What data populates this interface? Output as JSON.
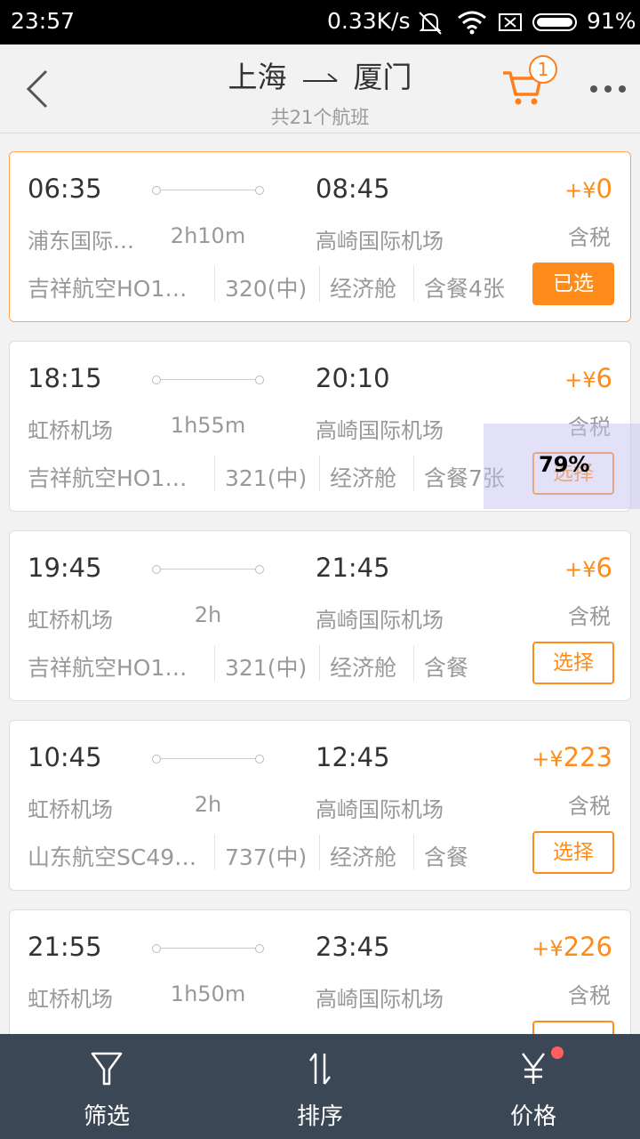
{
  "status_bar": {
    "time": "23:57",
    "network_speed": "0.33K/s",
    "battery": "91%"
  },
  "header": {
    "from": "上海",
    "to": "厦门",
    "subtitle": "共21个航班",
    "cart_count": "1"
  },
  "flights": [
    {
      "dep_time": "06:35",
      "arr_time": "08:45",
      "dep_airport": "浦东国际…",
      "arr_airport": "高崎国际机场",
      "duration": "2h10m",
      "price_prefix": "+¥",
      "price": "0",
      "tax": "含税",
      "airline": "吉祥航空HO1…",
      "plane": "320(中)",
      "cabin": "经济舱",
      "meal": "含餐4张",
      "button": "已选",
      "selected": true
    },
    {
      "dep_time": "18:15",
      "arr_time": "20:10",
      "dep_airport": "虹桥机场",
      "arr_airport": "高崎国际机场",
      "duration": "1h55m",
      "price_prefix": "+¥",
      "price": "6",
      "tax": "含税",
      "airline": "吉祥航空HO1…",
      "plane": "321(中)",
      "cabin": "经济舱",
      "meal": "含餐7张",
      "button": "选择",
      "selected": false
    },
    {
      "dep_time": "19:45",
      "arr_time": "21:45",
      "dep_airport": "虹桥机场",
      "arr_airport": "高崎国际机场",
      "duration": "2h",
      "price_prefix": "+¥",
      "price": "6",
      "tax": "含税",
      "airline": "吉祥航空HO1…",
      "plane": "321(中)",
      "cabin": "经济舱",
      "meal": "含餐",
      "button": "选择",
      "selected": false
    },
    {
      "dep_time": "10:45",
      "arr_time": "12:45",
      "dep_airport": "虹桥机场",
      "arr_airport": "高崎国际机场",
      "duration": "2h",
      "price_prefix": "+¥",
      "price": "223",
      "tax": "含税",
      "airline": "山东航空SC49…",
      "plane": "737(中)",
      "cabin": "经济舱",
      "meal": "含餐",
      "button": "选择",
      "selected": false
    },
    {
      "dep_time": "21:55",
      "arr_time": "23:45",
      "dep_airport": "虹桥机场",
      "arr_airport": "高崎国际机场",
      "duration": "1h50m",
      "price_prefix": "+¥",
      "price": "226",
      "tax": "含税",
      "airline": "",
      "plane": "",
      "cabin": "",
      "meal": "",
      "button": "",
      "selected": false
    }
  ],
  "overlay_text": "79%",
  "tabs": [
    {
      "label": "筛选",
      "icon": "filter-icon"
    },
    {
      "label": "排序",
      "icon": "sort-icon"
    },
    {
      "label": "价格",
      "icon": "yen-icon"
    }
  ],
  "colors": {
    "accent": "#ff8c1a",
    "tabbar": "#3c4756",
    "badge_dot": "#ff5e5e"
  }
}
